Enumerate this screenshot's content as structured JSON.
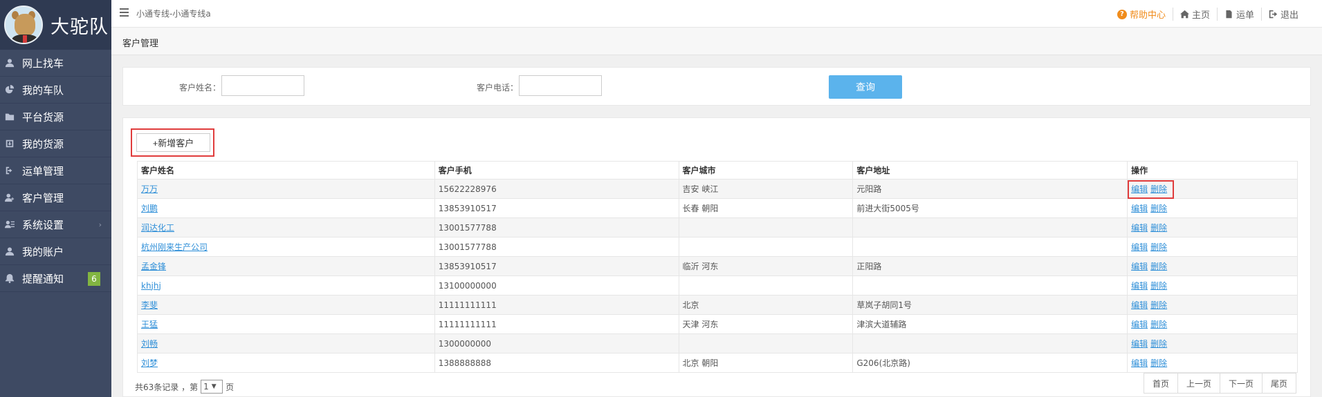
{
  "brand": {
    "name": "大驼队"
  },
  "sidebar": {
    "items": [
      {
        "label": "网上找车",
        "icon": "user-icon"
      },
      {
        "label": "我的车队",
        "icon": "pie-chart-icon"
      },
      {
        "label": "平台货源",
        "icon": "folder-icon"
      },
      {
        "label": "我的货源",
        "icon": "download-box-icon"
      },
      {
        "label": "运单管理",
        "icon": "sign-in-icon"
      },
      {
        "label": "客户管理",
        "icon": "add-user-icon"
      },
      {
        "label": "系统设置",
        "icon": "settings-list-icon",
        "chevron": "›"
      },
      {
        "label": "我的账户",
        "icon": "user-icon"
      },
      {
        "label": "提醒通知",
        "icon": "bell-icon",
        "badge": "6"
      }
    ]
  },
  "topbar": {
    "breadcrumb": "小通专线-小通专线a",
    "help": "帮助中心",
    "home": "主页",
    "waybill": "运单",
    "logout": "退出"
  },
  "page": {
    "title": "客户管理"
  },
  "search": {
    "name_label": "客户姓名：",
    "phone_label": "客户电话：",
    "name_value": "",
    "phone_value": "",
    "button": "查询"
  },
  "toolbar": {
    "add_label": "+新增客户"
  },
  "table": {
    "headers": [
      "客户姓名",
      "客户手机",
      "客户城市",
      "客户地址",
      "操作"
    ],
    "edit_label": "编辑",
    "delete_label": "删除",
    "rows": [
      {
        "name": "万万",
        "phone": "15622228976",
        "city": "吉安 峡江",
        "address": "元阳路"
      },
      {
        "name": "刘鹏",
        "phone": "13853910517",
        "city": "长春 朝阳",
        "address": "前进大街5005号"
      },
      {
        "name": "润达化工",
        "phone": "13001577788",
        "city": "",
        "address": ""
      },
      {
        "name": "杭州刚来生产公司",
        "phone": "13001577788",
        "city": "",
        "address": ""
      },
      {
        "name": "孟金锋",
        "phone": "13853910517",
        "city": "临沂 河东",
        "address": "正阳路"
      },
      {
        "name": "khjhj",
        "phone": "13100000000",
        "city": "",
        "address": ""
      },
      {
        "name": "李斐",
        "phone": "11111111111",
        "city": "北京",
        "address": "草岚子胡同1号"
      },
      {
        "name": "王猛",
        "phone": "11111111111",
        "city": "天津 河东",
        "address": "津滨大道辅路"
      },
      {
        "name": "刘畅",
        "phone": "1300000000",
        "city": "",
        "address": ""
      },
      {
        "name": "刘梦",
        "phone": "1388888888",
        "city": "北京 朝阳",
        "address": "G206(北京路)"
      }
    ]
  },
  "pagination": {
    "total_text": "共63条记录 ，第",
    "current_page": "1",
    "page_suffix": "页",
    "first": "首页",
    "prev": "上一页",
    "next": "下一页",
    "last": "尾页"
  }
}
